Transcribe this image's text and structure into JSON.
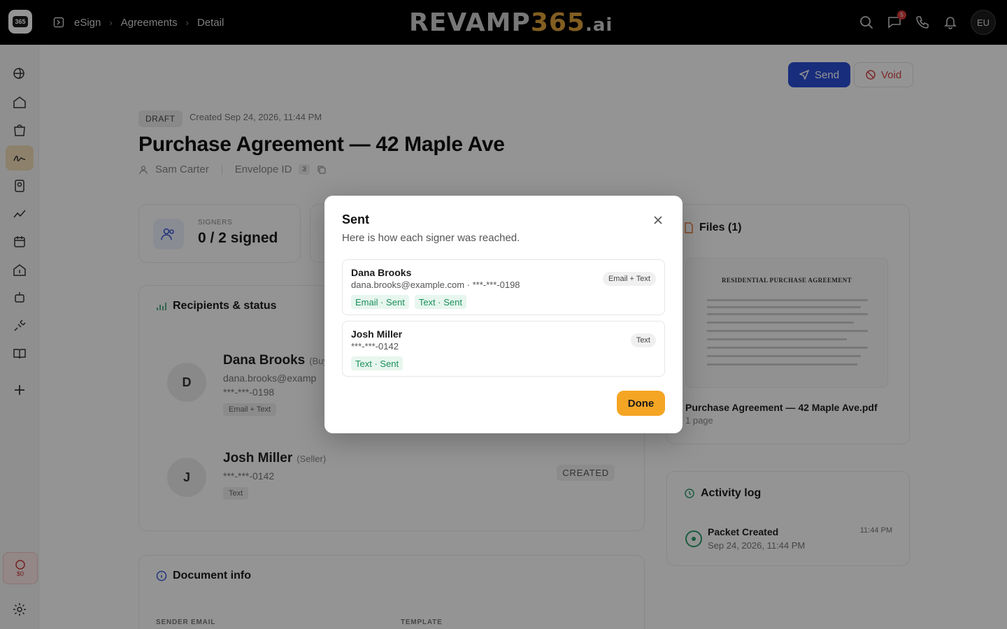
{
  "breadcrumb": {
    "items": [
      "eSign",
      "Agreements",
      "Detail"
    ]
  },
  "brand": {
    "part1": "REVAMP",
    "part2": "365",
    "part3": ".ai"
  },
  "topbar": {
    "chat_badge": "5",
    "avatar_initials": "EU"
  },
  "sidebar": {
    "active_item": "esign",
    "promo_value": "$0"
  },
  "actions": {
    "send_label": "Send",
    "void_label": "Void"
  },
  "agreement": {
    "status": "DRAFT",
    "created": "Created Sep 24, 2026, 11:44 PM",
    "title": "Purchase Agreement — 42 Maple Ave",
    "owner": "Sam Carter",
    "envelope_label": "Envelope ID",
    "envelope_value": "3"
  },
  "kpis": {
    "signers_label": "SIGNERS",
    "signers_value": "0 / 2 signed"
  },
  "recipients": {
    "title": "Recipients & status",
    "items": [
      {
        "initial": "D",
        "name": "Dana Brooks",
        "role": "(Buy",
        "email": "dana.brooks@examp",
        "phone": "***-***-0198",
        "method": "Email + Text",
        "status": ""
      },
      {
        "initial": "J",
        "name": "Josh Miller",
        "role": "(Seller)",
        "email": "",
        "phone": "***-***-0142",
        "method": "Text",
        "status": "CREATED"
      }
    ]
  },
  "files": {
    "title": "Files (1)",
    "thumb_title": "RESIDENTIAL PURCHASE AGREEMENT",
    "file_name": "Purchase Agreement — 42 Maple Ave.pdf",
    "pages": "1 page"
  },
  "activity": {
    "title": "Activity log",
    "items": [
      {
        "title": "Packet Created",
        "date": "Sep 24, 2026, 11:44 PM",
        "time": "11:44 PM"
      }
    ]
  },
  "document_info": {
    "title": "Document info",
    "sender_email_label": "SENDER EMAIL",
    "template_label": "TEMPLATE"
  },
  "modal": {
    "title": "Sent",
    "subtitle": "Here is how each signer was reached.",
    "signers": [
      {
        "name": "Dana Brooks",
        "contact": "dana.brooks@example.com · ***-***-0198",
        "method": "Email + Text",
        "chips": [
          "Email · Sent",
          "Text · Sent"
        ]
      },
      {
        "name": "Josh Miller",
        "contact": "***-***-0142",
        "method": "Text",
        "chips": [
          "Text · Sent"
        ]
      }
    ],
    "done_label": "Done"
  },
  "colors": {
    "primary": "#2a4fd6",
    "accent": "#f5a524",
    "success": "#1b8f5a",
    "danger": "#d64545"
  }
}
